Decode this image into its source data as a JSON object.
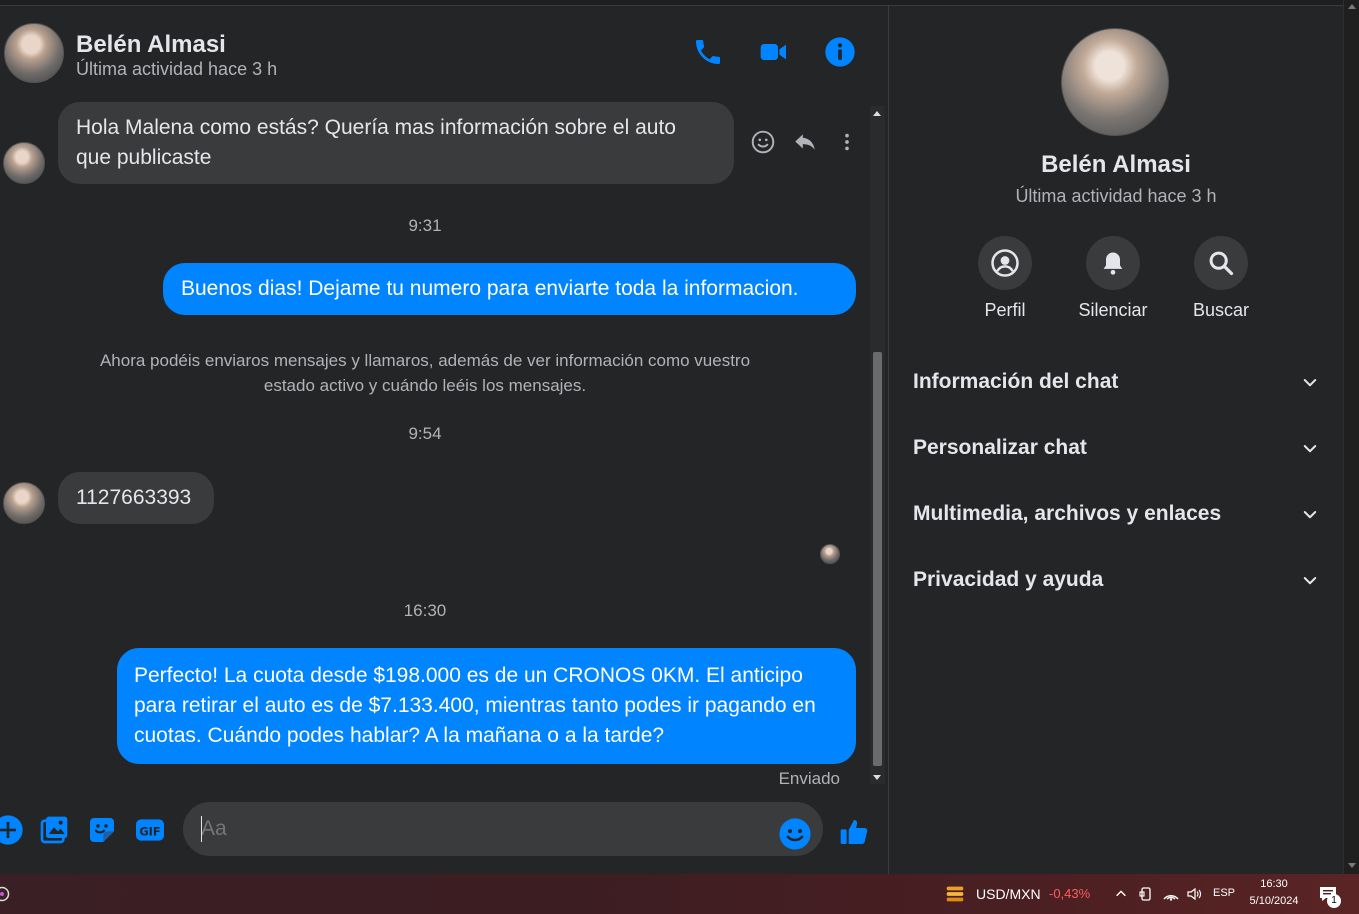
{
  "header": {
    "name": "Belén Almasi",
    "status": "Última actividad hace 3 h",
    "icons": [
      "phone-icon",
      "video-icon",
      "info-icon"
    ]
  },
  "messages": {
    "m1": "Hola Malena como estás? Quería mas información sobre el auto que publicaste",
    "t1": "9:31",
    "m2": "Buenos dias! Dejame tu numero para enviarte toda la informacion.",
    "sys": "Ahora podéis enviaros mensajes y llamaros, además de ver información como vuestro estado activo y cuándo leéis los mensajes.",
    "t2": "9:54",
    "m3": "1127663393",
    "t3": "16:30",
    "m4": "Perfecto! La cuota desde $198.000 es de un CRONOS 0KM. El anticipo para retirar el auto es de $7.133.400, mientras tanto podes ir pagando en cuotas. Cuándo podes hablar? A la mañana o a la tarde?",
    "sent": "Enviado"
  },
  "composer": {
    "placeholder": "Aa"
  },
  "panel": {
    "name": "Belén Almasi",
    "status": "Última actividad hace 3 h",
    "actions": [
      "Perfil",
      "Silenciar",
      "Buscar"
    ],
    "sections": [
      "Información del chat",
      "Personalizar chat",
      "Multimedia, archivos y enlaces",
      "Privacidad y ayuda"
    ]
  },
  "taskbar": {
    "ticker": "USD/MXN",
    "change": "-0,43%",
    "lang": "ESP",
    "time": "16:30",
    "date": "5/10/2024",
    "notif_count": "1"
  },
  "colors": {
    "accent": "#0084ff",
    "bg": "#242526",
    "bubble_in": "#3a3b3c",
    "negative": "#ff5c5c"
  }
}
